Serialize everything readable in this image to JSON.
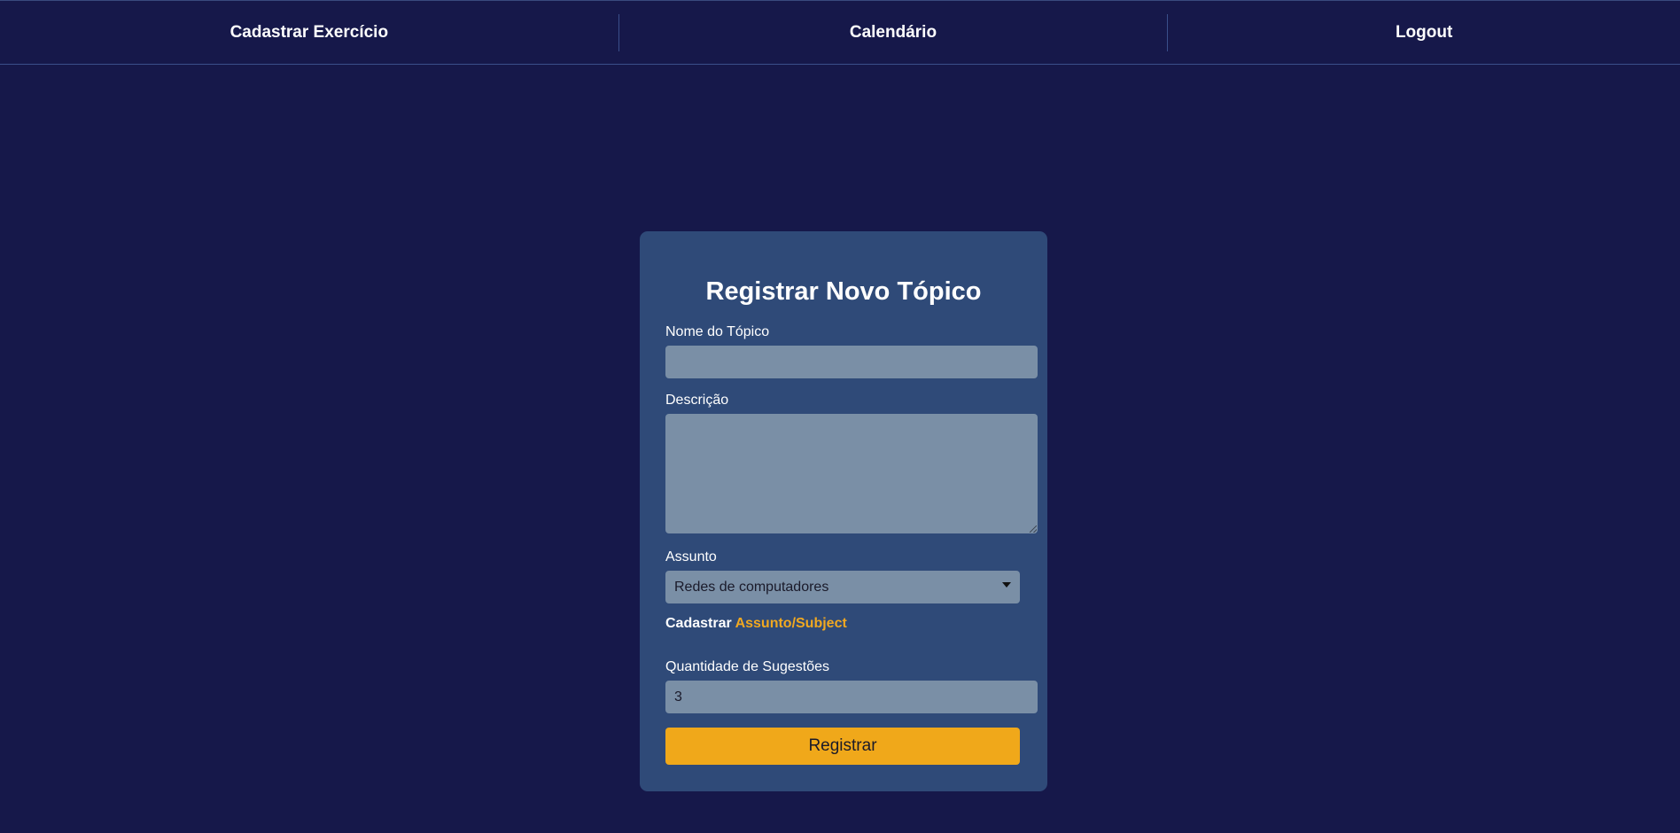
{
  "nav": {
    "items": [
      {
        "label": "Cadastrar Exercício"
      },
      {
        "label": "Calendário"
      },
      {
        "label": "Logout"
      }
    ]
  },
  "form": {
    "title": "Registrar Novo Tópico",
    "name_label": "Nome do Tópico",
    "name_value": "",
    "description_label": "Descrição",
    "description_value": "",
    "subject_label": "Assunto",
    "subject_selected": "Redes de computadores",
    "register_prefix": "Cadastrar",
    "register_link": "Assunto/Subject",
    "quantity_label": "Quantidade de Sugestões",
    "quantity_value": "3",
    "submit_label": "Registrar"
  },
  "colors": {
    "background": "#16184a",
    "card": "#2f4a78",
    "field": "#7a8fa6",
    "accent": "#f0a81a"
  }
}
